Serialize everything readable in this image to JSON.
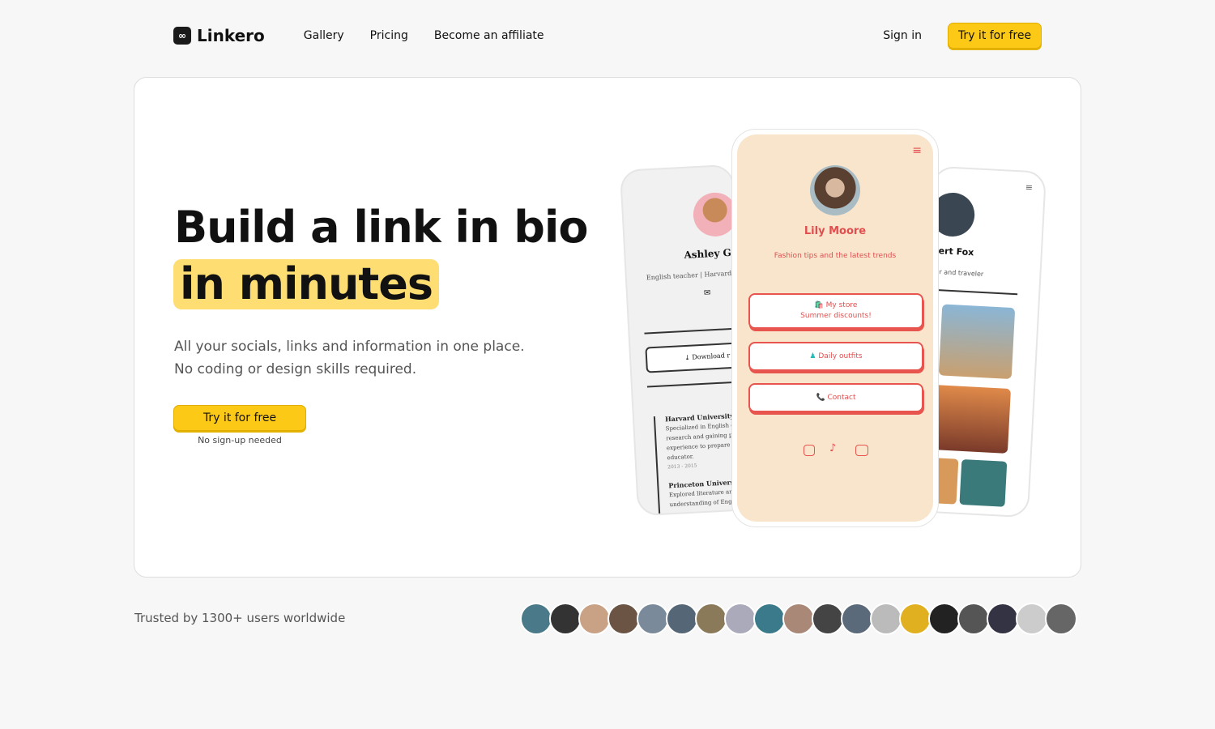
{
  "nav": {
    "brand": "Linkero",
    "links": [
      "Gallery",
      "Pricing",
      "Become an affiliate"
    ],
    "sign_in": "Sign in",
    "cta": "Try it for free"
  },
  "hero": {
    "title_line1": "Build a link in bio",
    "title_line2": "in minutes",
    "subtitle_line1": "All your socials, links and information in one place.",
    "subtitle_line2": "No coding or design skills required.",
    "cta": "Try it for free",
    "note": "No sign-up needed"
  },
  "phones": {
    "left": {
      "name": "Ashley G",
      "bio": "English teacher | Harvard",
      "button": "⤓ Download r",
      "items": [
        {
          "title": "Harvard University",
          "text": "Specialized in English o research and gaining pr experience to prepare f educator.",
          "years": "2013 - 2015"
        },
        {
          "title": "Princeton University",
          "text": "Explored literature and understanding of Engli"
        }
      ]
    },
    "center": {
      "name": "Lily Moore",
      "bio": "Fashion tips and the latest trends",
      "links": [
        {
          "label": "🛍️ My store",
          "sub": "Summer discounts!"
        },
        {
          "label": "Daily outfits"
        },
        {
          "label": "📞 Contact"
        }
      ],
      "socials": [
        "instagram-icon",
        "tiktok-icon",
        "youtube-icon"
      ]
    },
    "right": {
      "name": "bert Fox",
      "bio": "her and traveler"
    }
  },
  "trusted": {
    "text": "Trusted by 1300+ users worldwide",
    "avatar_colors": [
      "#4a7a8a",
      "#333",
      "#c9a184",
      "#6b5444",
      "#7a8a9a",
      "#556677",
      "#8a7a5a",
      "#aab",
      "#3a7a8a",
      "#aa8877",
      "#444",
      "#5a6a7a",
      "#bbb",
      "#e0b020",
      "#222",
      "#555",
      "#334",
      "#ccc",
      "#666"
    ]
  },
  "colors": {
    "accent": "#fcc917",
    "highlight": "#fedd72",
    "phone_accent": "#e8554e",
    "phone_bg": "#f9e4cc"
  }
}
